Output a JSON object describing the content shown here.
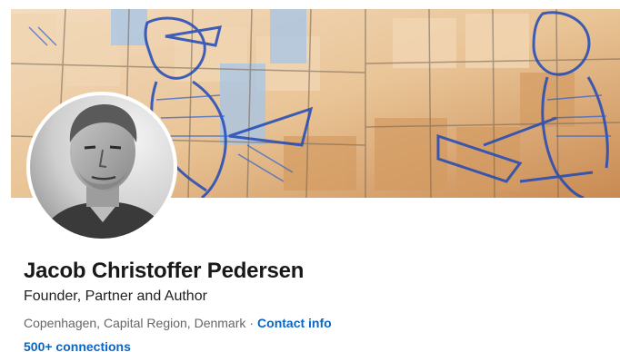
{
  "profile": {
    "name": "Jacob Christoffer Pedersen",
    "headline": "Founder, Partner and Author",
    "location": "Copenhagen, Capital Region, Denmark",
    "separator": "·",
    "contact_info_label": "Contact info",
    "connections_label": "500+ connections"
  },
  "colors": {
    "link": "#0a66c2",
    "name_text": "#191919",
    "secondary_text": "#666666"
  }
}
